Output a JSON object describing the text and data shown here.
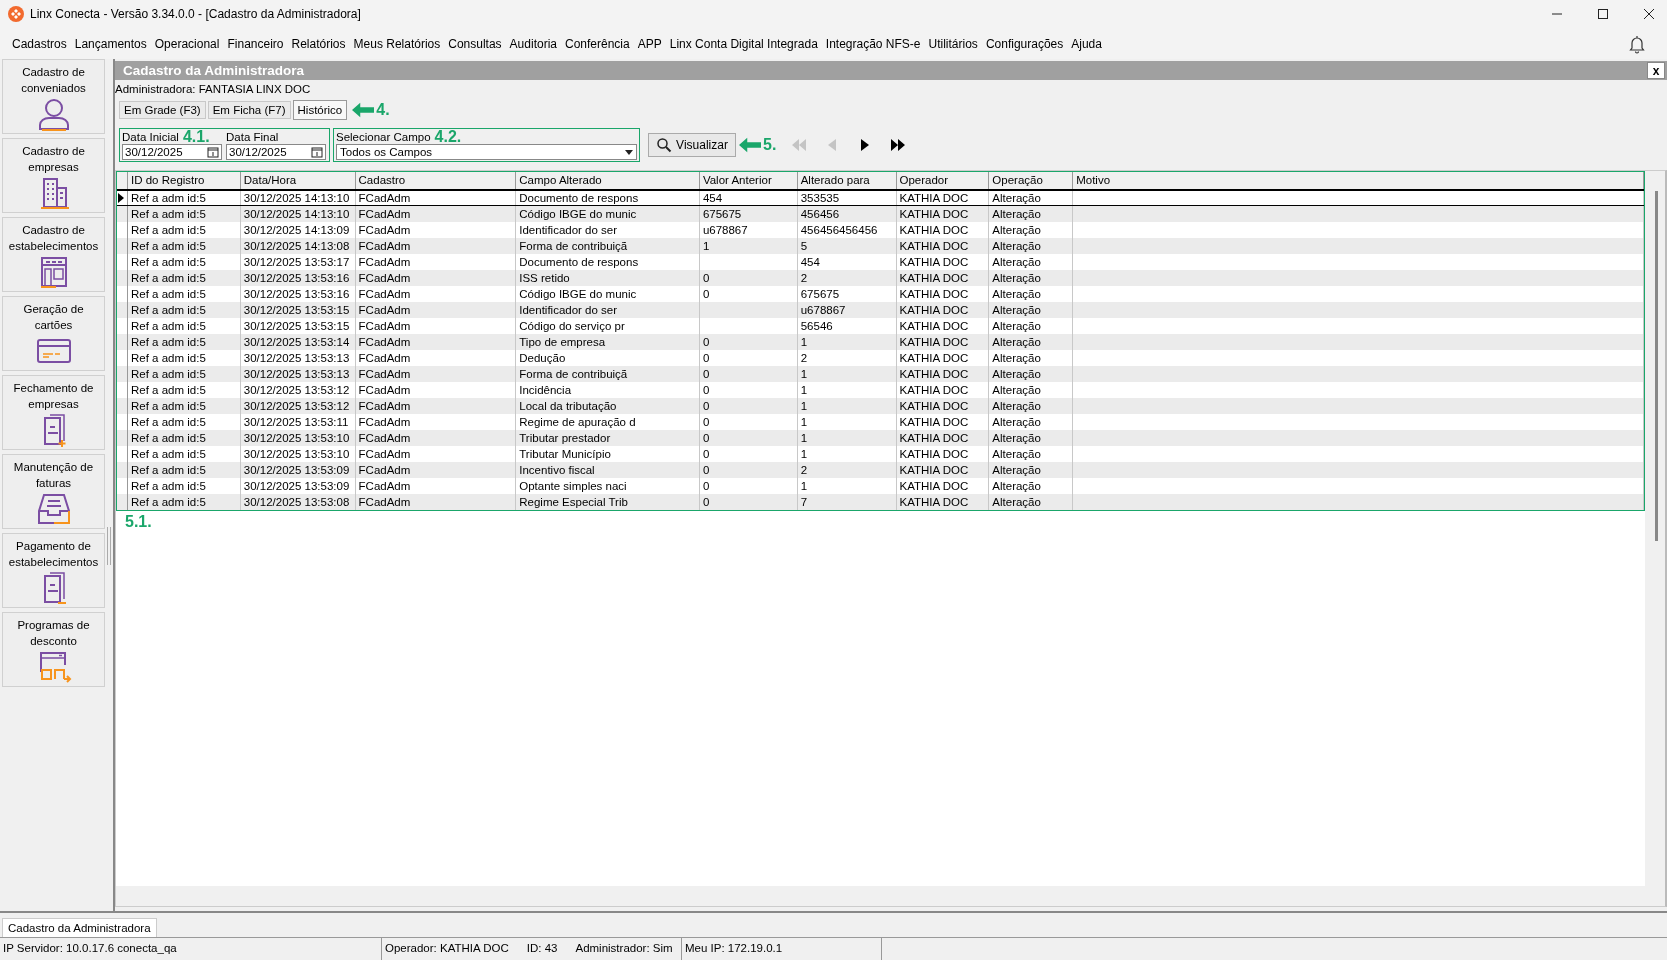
{
  "window": {
    "title": "Linx Conecta - Versão 3.34.0.0 - [Cadastro da Administradora]"
  },
  "menu": [
    "Cadastros",
    "Lançamentos",
    "Operacional",
    "Financeiro",
    "Relatórios",
    "Meus Relatórios",
    "Consultas",
    "Auditoria",
    "Conferência",
    "APP",
    "Linx Conta Digital Integrada",
    "Integração NFS-e",
    "Utilitários",
    "Configurações",
    "Ajuda"
  ],
  "sidebar": {
    "items": [
      {
        "label": "Cadastro de conveniados",
        "kind": "person"
      },
      {
        "label": "Cadastro de empresas",
        "kind": "buildings"
      },
      {
        "label": "Cadastro de estabelecimentos",
        "kind": "store"
      },
      {
        "label": "Geração de cartões",
        "kind": "card"
      },
      {
        "label": "Fechamento de empresas",
        "kind": "invoice-plus"
      },
      {
        "label": "Manutenção de faturas",
        "kind": "tray"
      },
      {
        "label": "Pagamento de estabelecimentos",
        "kind": "invoice-minus"
      },
      {
        "label": "Programas de desconto",
        "kind": "discount"
      }
    ]
  },
  "panel": {
    "title": "Cadastro da Administradora",
    "close": "x",
    "admin_label": "Administradora: FANTASIA LINX DOC"
  },
  "tabs": [
    {
      "label": "Em Grade (F3)",
      "selected": false
    },
    {
      "label": "Em Ficha (F7)",
      "selected": false
    },
    {
      "label": "Histórico",
      "selected": true,
      "annotation": "4."
    }
  ],
  "filters": {
    "start_label": "Data Inicial",
    "start_annotation": "4.1.",
    "start_value": "30/12/2025",
    "end_label": "Data Final",
    "end_value": "30/12/2025",
    "field_label": "Selecionar Campo",
    "field_annotation": "4.2.",
    "field_value": "Todos os Campos"
  },
  "view_button": {
    "label": "Visualizar",
    "annotation": "5."
  },
  "nav_buttons": [
    {
      "kind": "first",
      "disabled": true
    },
    {
      "kind": "prev",
      "disabled": true
    },
    {
      "kind": "next",
      "disabled": false
    },
    {
      "kind": "last",
      "disabled": false
    }
  ],
  "table": {
    "annotation": "5.1.",
    "columns": [
      "ID do Registro",
      "Data/Hora",
      "Cadastro",
      "Campo Alterado",
      "Valor Anterior",
      "Alterado para",
      "Operador",
      "Operação",
      "Motivo"
    ],
    "rows": [
      {
        "selected": true,
        "cells": [
          "Ref a adm id:5",
          "30/12/2025 14:13:10",
          "FCadAdm",
          "Documento de respons",
          "454",
          "353535",
          "KATHIA DOC",
          "Alteração",
          ""
        ]
      },
      {
        "selected": false,
        "cells": [
          "Ref a adm id:5",
          "30/12/2025 14:13:10",
          "FCadAdm",
          "Código IBGE do munic",
          "675675",
          "456456",
          "KATHIA DOC",
          "Alteração",
          ""
        ]
      },
      {
        "selected": false,
        "cells": [
          "Ref a adm id:5",
          "30/12/2025 14:13:09",
          "FCadAdm",
          "Identificador do ser",
          "u678867",
          "456456456456",
          "KATHIA DOC",
          "Alteração",
          ""
        ]
      },
      {
        "selected": false,
        "cells": [
          "Ref a adm id:5",
          "30/12/2025 14:13:08",
          "FCadAdm",
          "Forma de contribuiçã",
          "1",
          "5",
          "KATHIA DOC",
          "Alteração",
          ""
        ]
      },
      {
        "selected": false,
        "cells": [
          "Ref a adm id:5",
          "30/12/2025 13:53:17",
          "FCadAdm",
          "Documento de respons",
          "",
          "454",
          "KATHIA DOC",
          "Alteração",
          ""
        ]
      },
      {
        "selected": false,
        "cells": [
          "Ref a adm id:5",
          "30/12/2025 13:53:16",
          "FCadAdm",
          "ISS retido",
          "0",
          "2",
          "KATHIA DOC",
          "Alteração",
          ""
        ]
      },
      {
        "selected": false,
        "cells": [
          "Ref a adm id:5",
          "30/12/2025 13:53:16",
          "FCadAdm",
          "Código IBGE do munic",
          "0",
          "675675",
          "KATHIA DOC",
          "Alteração",
          ""
        ]
      },
      {
        "selected": false,
        "cells": [
          "Ref a adm id:5",
          "30/12/2025 13:53:15",
          "FCadAdm",
          "Identificador do ser",
          "",
          "u678867",
          "KATHIA DOC",
          "Alteração",
          ""
        ]
      },
      {
        "selected": false,
        "cells": [
          "Ref a adm id:5",
          "30/12/2025 13:53:15",
          "FCadAdm",
          "Código do serviço pr",
          "",
          "56546",
          "KATHIA DOC",
          "Alteração",
          ""
        ]
      },
      {
        "selected": false,
        "cells": [
          "Ref a adm id:5",
          "30/12/2025 13:53:14",
          "FCadAdm",
          "Tipo de empresa",
          "0",
          "1",
          "KATHIA DOC",
          "Alteração",
          ""
        ]
      },
      {
        "selected": false,
        "cells": [
          "Ref a adm id:5",
          "30/12/2025 13:53:13",
          "FCadAdm",
          "Dedução",
          "0",
          "2",
          "KATHIA DOC",
          "Alteração",
          ""
        ]
      },
      {
        "selected": false,
        "cells": [
          "Ref a adm id:5",
          "30/12/2025 13:53:13",
          "FCadAdm",
          "Forma de contribuiçã",
          "0",
          "1",
          "KATHIA DOC",
          "Alteração",
          ""
        ]
      },
      {
        "selected": false,
        "cells": [
          "Ref a adm id:5",
          "30/12/2025 13:53:12",
          "FCadAdm",
          "Incidência",
          "0",
          "1",
          "KATHIA DOC",
          "Alteração",
          ""
        ]
      },
      {
        "selected": false,
        "cells": [
          "Ref a adm id:5",
          "30/12/2025 13:53:12",
          "FCadAdm",
          "Local da tributação",
          "0",
          "1",
          "KATHIA DOC",
          "Alteração",
          ""
        ]
      },
      {
        "selected": false,
        "cells": [
          "Ref a adm id:5",
          "30/12/2025 13:53:11",
          "FCadAdm",
          "Regime de apuração d",
          "0",
          "1",
          "KATHIA DOC",
          "Alteração",
          ""
        ]
      },
      {
        "selected": false,
        "cells": [
          "Ref a adm id:5",
          "30/12/2025 13:53:10",
          "FCadAdm",
          "Tributar prestador",
          "0",
          "1",
          "KATHIA DOC",
          "Alteração",
          ""
        ]
      },
      {
        "selected": false,
        "cells": [
          "Ref a adm id:5",
          "30/12/2025 13:53:10",
          "FCadAdm",
          "Tributar Município",
          "0",
          "1",
          "KATHIA DOC",
          "Alteração",
          ""
        ]
      },
      {
        "selected": false,
        "cells": [
          "Ref a adm id:5",
          "30/12/2025 13:53:09",
          "FCadAdm",
          "Incentivo fiscal",
          "0",
          "2",
          "KATHIA DOC",
          "Alteração",
          ""
        ]
      },
      {
        "selected": false,
        "cells": [
          "Ref a adm id:5",
          "30/12/2025 13:53:09",
          "FCadAdm",
          "Optante simples naci",
          "0",
          "1",
          "KATHIA DOC",
          "Alteração",
          ""
        ]
      },
      {
        "selected": false,
        "cells": [
          "Ref a adm id:5",
          "30/12/2025 13:53:08",
          "FCadAdm",
          "Regime Especial Trib",
          "0",
          "7",
          "KATHIA DOC",
          "Alteração",
          ""
        ]
      }
    ]
  },
  "window_tabs": [
    {
      "label": "Cadastro da Administradora",
      "selected": true
    }
  ],
  "status_bar": [
    "IP Servidor: 10.0.17.6 conecta_qa",
    "Operador: KATHIA DOC",
    "ID: 43",
    "Administrador: Sim",
    "Meu IP: 172.19.0.1"
  ]
}
